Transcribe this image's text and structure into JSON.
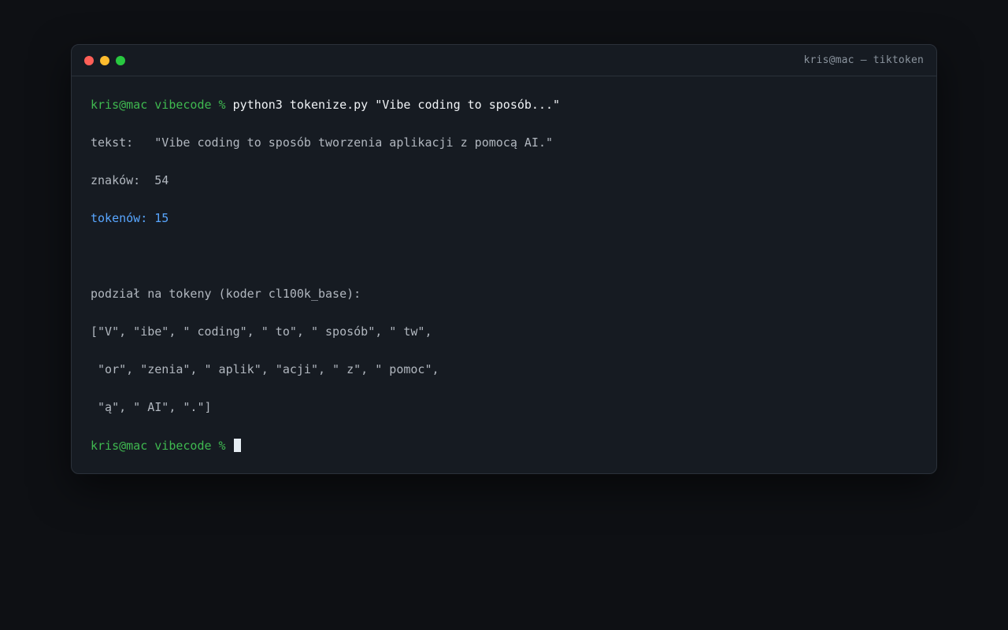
{
  "window": {
    "title": "kris@mac — tiktoken",
    "traffic_lights": {
      "close_color": "#ff5f57",
      "minimize_color": "#febc2e",
      "zoom_color": "#28c840"
    }
  },
  "terminal": {
    "prompt": "kris@mac vibecode %",
    "command": "python3 tokenize.py \"Vibe coding to sposób...\"",
    "tekst_label": "tekst:",
    "tekst_value": "\"Vibe coding to sposób tworzenia aplikacji z pomocą AI.\"",
    "znakow_label": "znaków:",
    "znakow_value": "54",
    "tokenow_label": "tokenów:",
    "tokenow_value": "15",
    "split_header": "podział na tokeny (koder cl100k_base):",
    "token_lines": [
      "[\"V\", \"ibe\", \" coding\", \" to\", \" sposób\", \" tw\",",
      " \"or\", \"zenia\", \" aplik\", \"acji\", \" z\", \" pomoc\",",
      " \"ą\", \" AI\", \".\"]"
    ],
    "final_prompt": "kris@mac vibecode %"
  },
  "colors": {
    "background": "#0e1014",
    "window_bg": "#161b22",
    "prompt": "#3fb950",
    "accent": "#58a6ff",
    "text": "#b1b7bf"
  }
}
